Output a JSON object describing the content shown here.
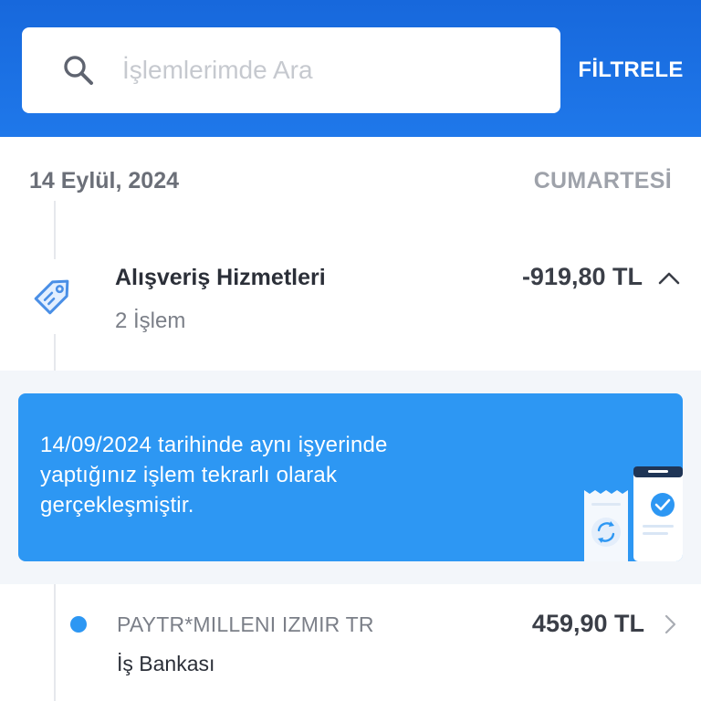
{
  "search": {
    "placeholder": "İşlemlerimde Ara",
    "value": ""
  },
  "header": {
    "filter_label": "FİLTRELE"
  },
  "date_group": {
    "date": "14 Eylül, 2024",
    "weekday": "CUMARTESİ"
  },
  "category": {
    "icon": "tag-icon",
    "title": "Alışveriş Hizmetleri",
    "count_text": "2 İşlem",
    "amount": "-919,80 TL",
    "expanded": true
  },
  "alert": {
    "message": "14/09/2024 tarihinde aynı işyerinde yaptığınız işlem tekrarlı olarak gerçekleşmiştir.",
    "icon": "receipt-check-illustration"
  },
  "transactions": [
    {
      "merchant": "PAYTR*MILLENI IZMIR TR",
      "bank": "İş Bankası",
      "amount": "459,90 TL"
    }
  ],
  "colors": {
    "header_blue": "#1a6fe3",
    "alert_blue": "#2d97f3",
    "dot_blue": "#2d97f3"
  }
}
